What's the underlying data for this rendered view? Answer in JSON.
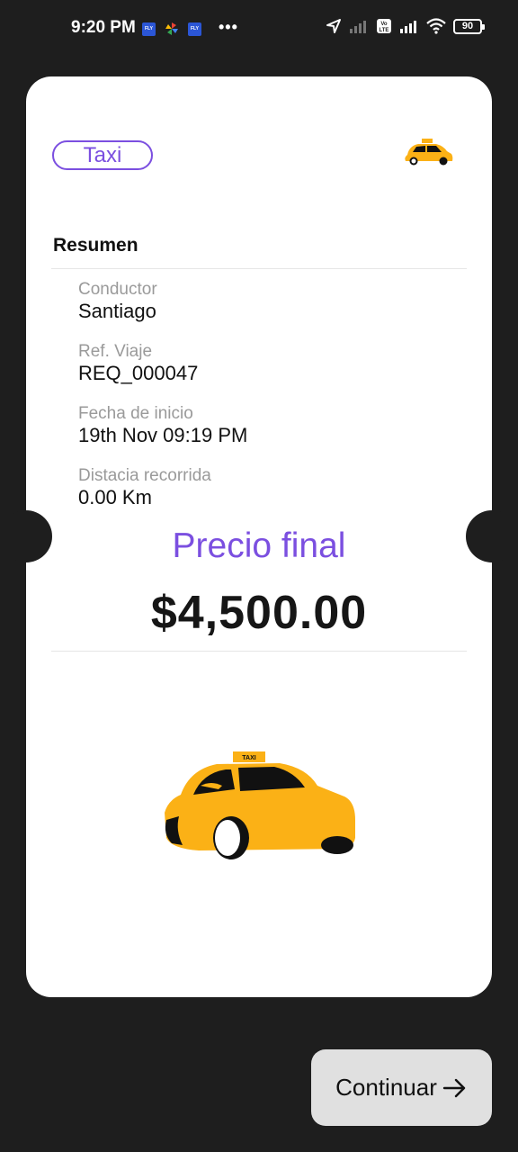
{
  "status_bar": {
    "time": "9:20 PM",
    "notif_fly": "FLY",
    "more": "•••",
    "battery": "90",
    "volte": "Vo LTE"
  },
  "ticket": {
    "type_pill": "Taxi",
    "summary_title": "Resumen",
    "fields": [
      {
        "label": "Conductor",
        "value": "Santiago"
      },
      {
        "label": "Ref. Viaje",
        "value": "REQ_000047"
      },
      {
        "label": "Fecha de inicio",
        "value": "19th Nov 09:19 PM"
      },
      {
        "label": "Distacia recorrida",
        "value": "0.00 Km"
      }
    ],
    "price_label": "Precio final",
    "price_value": "$4,500.00",
    "taxi_sign": "TAXI"
  },
  "actions": {
    "continue_label": "Continuar"
  },
  "colors": {
    "background": "#1e1e1e",
    "accent": "#7b4fe0",
    "taxi_yellow": "#fbb116",
    "button_bg": "#e0e0e0"
  },
  "icons": {
    "small_vehicle": "taxi-icon",
    "vehicle_image": "taxi-illustration",
    "continue": "arrow-right-icon"
  }
}
